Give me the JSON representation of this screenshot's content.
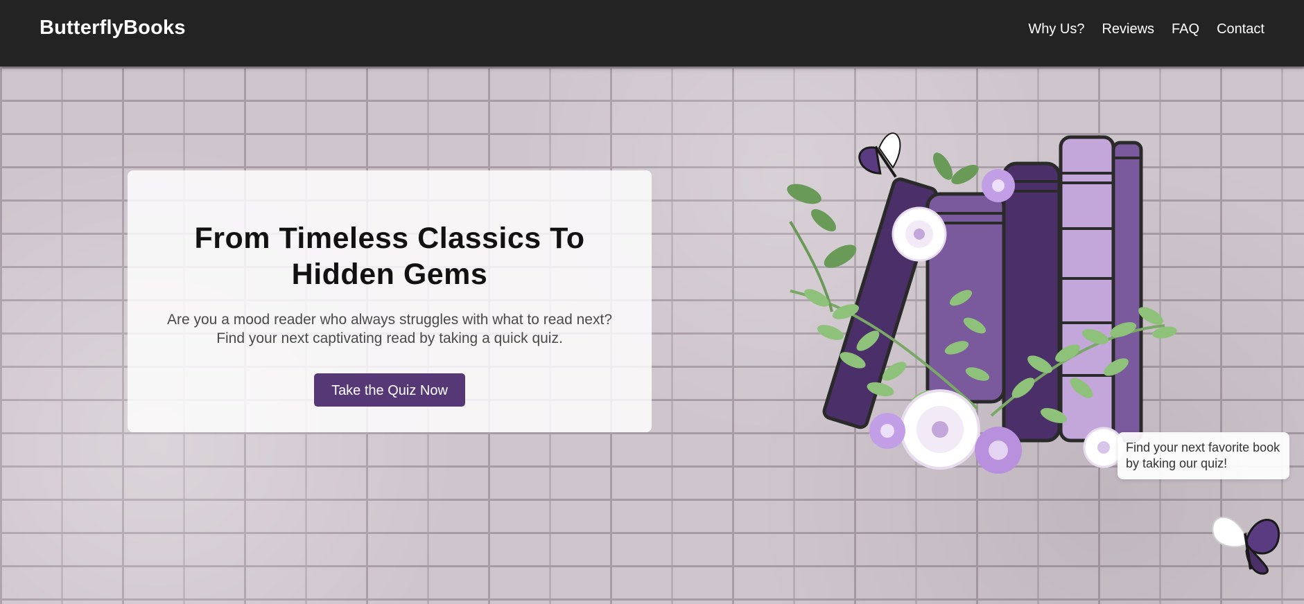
{
  "header": {
    "logo": "ButterflyBooks",
    "nav": [
      {
        "label": "Why Us?"
      },
      {
        "label": "Reviews"
      },
      {
        "label": "FAQ"
      },
      {
        "label": "Contact"
      }
    ]
  },
  "hero": {
    "title": "From Timeless Classics To Hidden Gems",
    "subtitle": "Are you a mood reader who always struggles with what to read next? Find your next captivating read by taking a quick quiz.",
    "cta_label": "Take the Quiz Now"
  },
  "tooltip": {
    "text": "Find your next favorite book by taking our quiz!"
  },
  "icons": {
    "illustration": "books-flowers-butterfly-illustration",
    "corner": "butterfly-icon"
  },
  "colors": {
    "navbar": "#232323",
    "accent": "#563877",
    "book_dark": "#4a2f68",
    "book_mid": "#7a5a9c",
    "book_light": "#c3a6da",
    "leaf": "#8ec27a"
  }
}
